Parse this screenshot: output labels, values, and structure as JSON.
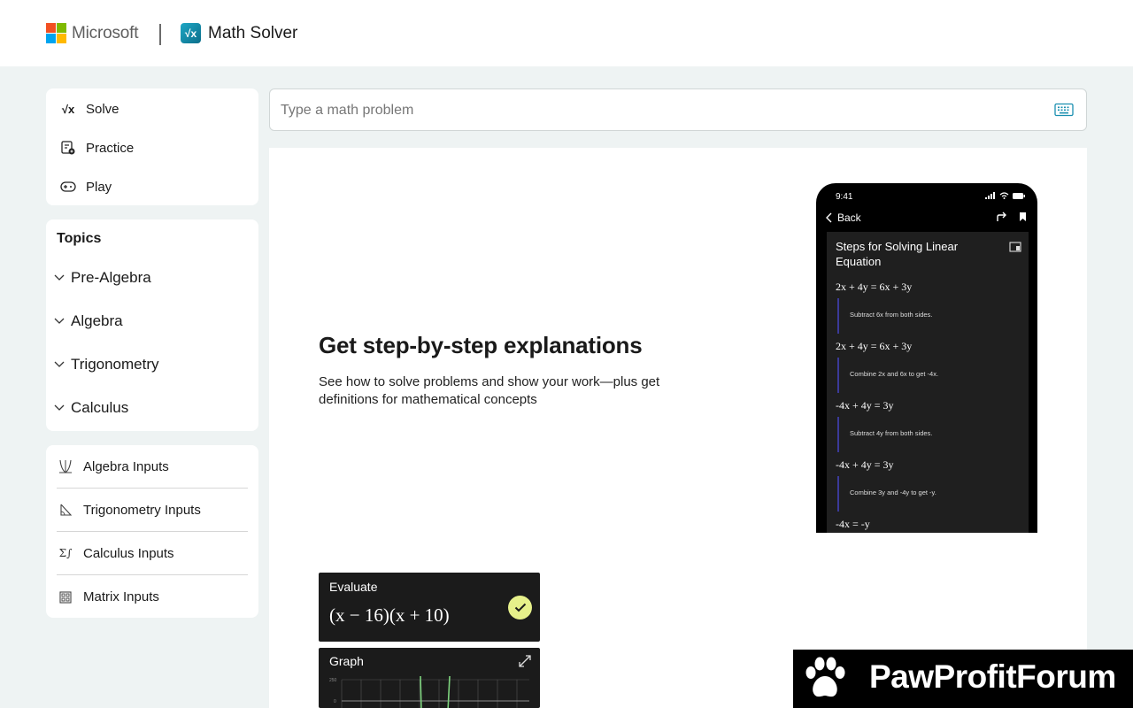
{
  "header": {
    "brand": "Microsoft",
    "app_name": "Math Solver",
    "app_icon_glyph": "√x"
  },
  "nav": {
    "items": [
      {
        "label": "Solve",
        "icon": "sqrt-x-icon"
      },
      {
        "label": "Practice",
        "icon": "practice-icon"
      },
      {
        "label": "Play",
        "icon": "gamepad-icon"
      }
    ]
  },
  "topics": {
    "title": "Topics",
    "items": [
      {
        "label": "Pre-Algebra"
      },
      {
        "label": "Algebra"
      },
      {
        "label": "Trigonometry"
      },
      {
        "label": "Calculus"
      }
    ]
  },
  "inputs": {
    "items": [
      {
        "label": "Algebra Inputs",
        "icon": "algebra-inputs-icon"
      },
      {
        "label": "Trigonometry Inputs",
        "icon": "trigonometry-inputs-icon"
      },
      {
        "label": "Calculus Inputs",
        "icon": "calculus-inputs-icon"
      },
      {
        "label": "Matrix Inputs",
        "icon": "matrix-inputs-icon"
      }
    ]
  },
  "search": {
    "placeholder": "Type a math problem",
    "value": ""
  },
  "hero": {
    "title": "Get step-by-step explanations",
    "description": "See how to solve problems and show your work—plus get definitions for mathematical concepts"
  },
  "phone": {
    "time": "9:41",
    "back_label": "Back",
    "heading": "Steps for Solving Linear Equation",
    "steps": [
      {
        "equation": "2x + 4y = 6x + 3y",
        "note": "Subtract 6x from both sides."
      },
      {
        "equation": "2x + 4y = 6x + 3y",
        "note": "Combine 2x and 6x to get -4x."
      },
      {
        "equation": "-4x + 4y = 3y",
        "note": "Subtract 4y from both sides."
      },
      {
        "equation": "-4x + 4y = 3y",
        "note": "Combine 3y and -4y to get -y."
      },
      {
        "equation": "-4x = -y",
        "note": ""
      }
    ]
  },
  "evaluate": {
    "label": "Evaluate",
    "expression": "(x − 16)(x + 10)"
  },
  "graph": {
    "label": "Graph",
    "tick_top": "250",
    "tick_zero": "0"
  },
  "watermark": {
    "text": "PawProfitForum"
  },
  "colors": {
    "page_bg": "#eef3f3",
    "ms_red": "#f25022",
    "ms_green": "#7fba00",
    "ms_blue": "#00a4ef",
    "ms_yellow": "#ffb900",
    "app_accent": "#1ea7c5",
    "step_bar": "#3b3a99",
    "check_bg": "#e6f08a",
    "graph_curve": "#7ed47e"
  }
}
